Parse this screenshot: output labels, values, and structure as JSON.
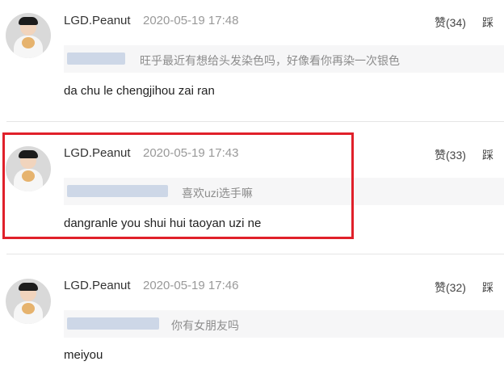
{
  "comments": [
    {
      "username": "LGD.Peanut",
      "time": "2020-05-19 17:48",
      "like_label": "赞(34)",
      "dislike_label": "踩",
      "reply_text": "旺乎最近有想给头发染色吗，好像看你再染一次银色",
      "content": "da chu le chengjihou zai ran"
    },
    {
      "username": "LGD.Peanut",
      "time": "2020-05-19 17:43",
      "like_label": "赞(33)",
      "dislike_label": "踩",
      "reply_text": "喜欢uzi选手嘛",
      "content": "dangranle you shui hui taoyan uzi ne"
    },
    {
      "username": "LGD.Peanut",
      "time": "2020-05-19 17:46",
      "like_label": "赞(32)",
      "dislike_label": "踩",
      "reply_text": "你有女朋友吗",
      "content": "meiyou"
    }
  ],
  "highlight_color": "#e0202a"
}
